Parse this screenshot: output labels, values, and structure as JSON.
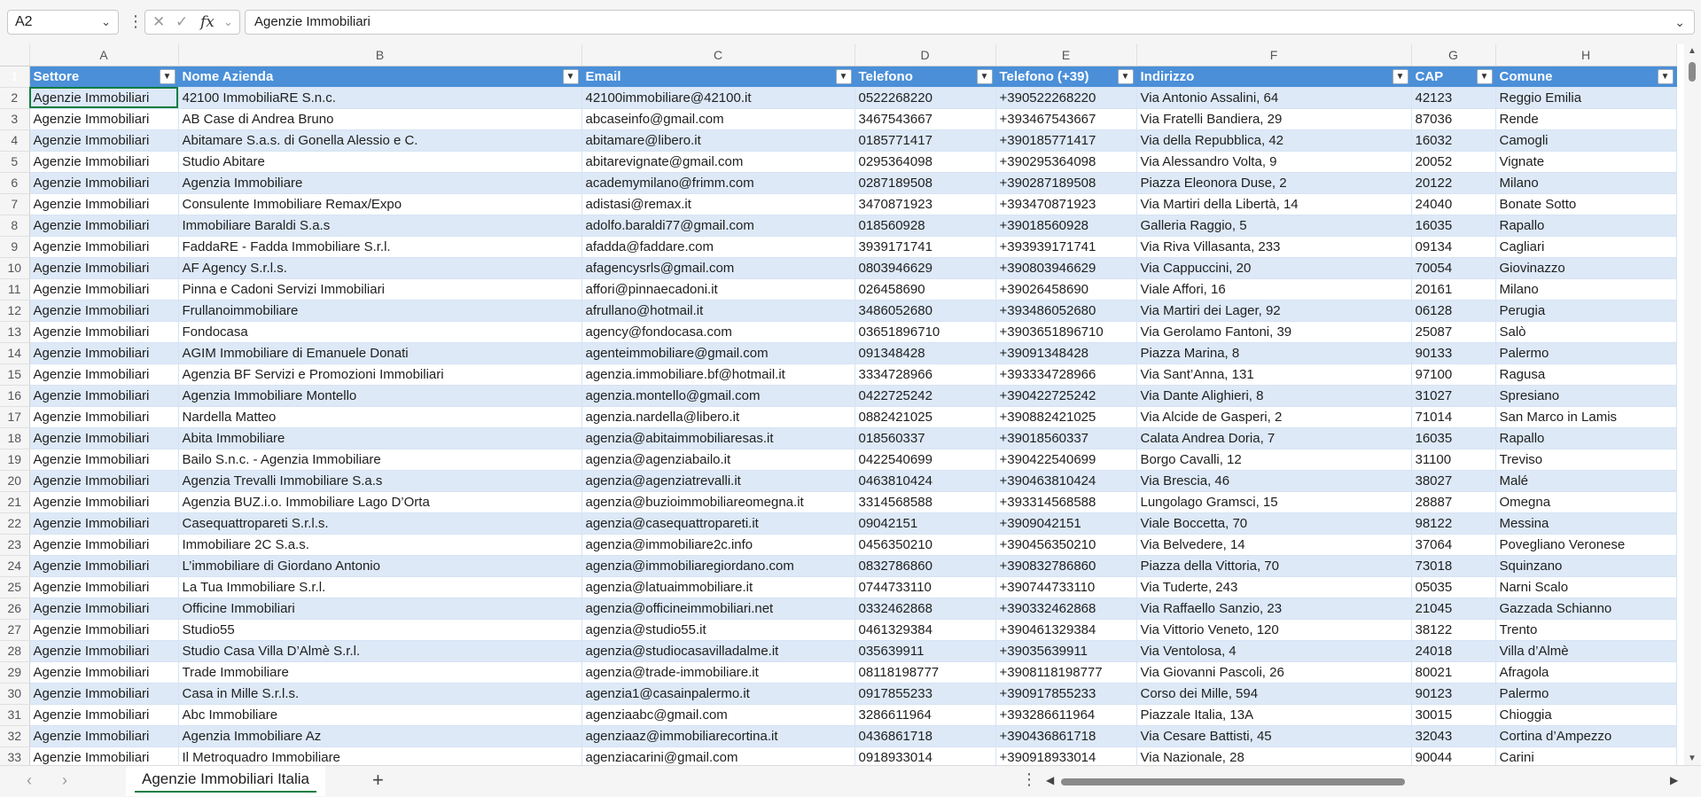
{
  "formula_bar": {
    "name_box": "A2",
    "formula_value": "Agenzie Immobiliari"
  },
  "columns": [
    "A",
    "B",
    "C",
    "D",
    "E",
    "F",
    "G",
    "H"
  ],
  "table_headers": [
    "Settore",
    "Nome Azienda",
    "Email",
    "Telefono",
    "Telefono (+39)",
    "Indirizzo",
    "CAP",
    "Comune"
  ],
  "row_numbers": [
    "1",
    "2",
    "3",
    "4",
    "5",
    "6",
    "7",
    "8",
    "9",
    "10",
    "11",
    "12",
    "13",
    "14",
    "15",
    "16",
    "17",
    "18",
    "19",
    "20",
    "21",
    "22",
    "23",
    "24",
    "25",
    "26",
    "27",
    "28",
    "29",
    "30",
    "31",
    "32",
    "33"
  ],
  "rows": [
    [
      "Agenzie Immobiliari",
      "42100 ImmobiliaRE S.n.c.",
      "42100immobiliare@42100.it",
      "0522268220",
      "+390522268220",
      "Via Antonio Assalini, 64",
      "42123",
      "Reggio Emilia"
    ],
    [
      "Agenzie Immobiliari",
      "AB Case di Andrea Bruno",
      "abcaseinfo@gmail.com",
      "3467543667",
      "+393467543667",
      "Via Fratelli Bandiera, 29",
      "87036",
      "Rende"
    ],
    [
      "Agenzie Immobiliari",
      "Abitamare S.a.s. di Gonella Alessio e C.",
      "abitamare@libero.it",
      "0185771417",
      "+390185771417",
      "Via della Repubblica, 42",
      "16032",
      "Camogli"
    ],
    [
      "Agenzie Immobiliari",
      "Studio Abitare",
      "abitarevignate@gmail.com",
      "0295364098",
      "+390295364098",
      "Via Alessandro Volta, 9",
      "20052",
      "Vignate"
    ],
    [
      "Agenzie Immobiliari",
      "Agenzia Immobiliare",
      "academymilano@frimm.com",
      "0287189508",
      "+390287189508",
      "Piazza Eleonora Duse, 2",
      "20122",
      "Milano"
    ],
    [
      "Agenzie Immobiliari",
      "Consulente Immobiliare Remax/Expo",
      "adistasi@remax.it",
      "3470871923",
      "+393470871923",
      "Via Martiri della Libertà, 14",
      "24040",
      "Bonate Sotto"
    ],
    [
      "Agenzie Immobiliari",
      "Immobiliare Baraldi S.a.s",
      "adolfo.baraldi77@gmail.com",
      "018560928",
      "+39018560928",
      "Galleria Raggio, 5",
      "16035",
      "Rapallo"
    ],
    [
      "Agenzie Immobiliari",
      "FaddaRE - Fadda Immobiliare S.r.l.",
      "afadda@faddare.com",
      "3939171741",
      "+393939171741",
      "Via Riva Villasanta, 233",
      "09134",
      "Cagliari"
    ],
    [
      "Agenzie Immobiliari",
      "AF Agency S.r.l.s.",
      "afagencysrls@gmail.com",
      "0803946629",
      "+390803946629",
      "Via Cappuccini, 20",
      "70054",
      "Giovinazzo"
    ],
    [
      "Agenzie Immobiliari",
      "Pinna e Cadoni Servizi Immobiliari",
      "affori@pinnaecadoni.it",
      "026458690",
      "+39026458690",
      "Viale Affori, 16",
      "20161",
      "Milano"
    ],
    [
      "Agenzie Immobiliari",
      "Frullanoimmobiliare",
      "afrullano@hotmail.it",
      "3486052680",
      "+393486052680",
      "Via Martiri dei Lager, 92",
      "06128",
      "Perugia"
    ],
    [
      "Agenzie Immobiliari",
      "Fondocasa",
      "agency@fondocasa.com",
      "03651896710",
      "+3903651896710",
      "Via Gerolamo Fantoni, 39",
      "25087",
      "Salò"
    ],
    [
      "Agenzie Immobiliari",
      "AGIM Immobiliare di Emanuele Donati",
      "agenteimmobiliare@gmail.com",
      "091348428",
      "+39091348428",
      "Piazza Marina, 8",
      "90133",
      "Palermo"
    ],
    [
      "Agenzie Immobiliari",
      "Agenzia BF Servizi e Promozioni Immobiliari",
      "agenzia.immobiliare.bf@hotmail.it",
      "3334728966",
      "+393334728966",
      "Via Sant’Anna, 131",
      "97100",
      "Ragusa"
    ],
    [
      "Agenzie Immobiliari",
      "Agenzia Immobiliare Montello",
      "agenzia.montello@gmail.com",
      "0422725242",
      "+390422725242",
      "Via Dante Alighieri, 8",
      "31027",
      "Spresiano"
    ],
    [
      "Agenzie Immobiliari",
      "Nardella Matteo",
      "agenzia.nardella@libero.it",
      "0882421025",
      "+390882421025",
      "Via Alcide de Gasperi, 2",
      "71014",
      "San Marco in Lamis"
    ],
    [
      "Agenzie Immobiliari",
      "Abita Immobiliare",
      "agenzia@abitaimmobiliaresas.it",
      "018560337",
      "+39018560337",
      "Calata Andrea Doria, 7",
      "16035",
      "Rapallo"
    ],
    [
      "Agenzie Immobiliari",
      "Bailo S.n.c. - Agenzia Immobiliare",
      "agenzia@agenziabailo.it",
      "0422540699",
      "+390422540699",
      "Borgo Cavalli, 12",
      "31100",
      "Treviso"
    ],
    [
      "Agenzie Immobiliari",
      "Agenzia Trevalli Immobiliare S.a.s",
      "agenzia@agenziatrevalli.it",
      "0463810424",
      "+390463810424",
      "Via Brescia, 46",
      "38027",
      "Malé"
    ],
    [
      "Agenzie Immobiliari",
      "Agenzia BUZ.i.o. Immobiliare Lago D’Orta",
      "agenzia@buzioimmobiliareomegna.it",
      "3314568588",
      "+393314568588",
      "Lungolago Gramsci, 15",
      "28887",
      "Omegna"
    ],
    [
      "Agenzie Immobiliari",
      "Casequattropareti S.r.l.s.",
      "agenzia@casequattropareti.it",
      "09042151",
      "+3909042151",
      "Viale Boccetta, 70",
      "98122",
      "Messina"
    ],
    [
      "Agenzie Immobiliari",
      "Immobiliare 2C S.a.s.",
      "agenzia@immobiliare2c.info",
      "0456350210",
      "+390456350210",
      "Via Belvedere, 14",
      "37064",
      "Povegliano Veronese"
    ],
    [
      "Agenzie Immobiliari",
      "L’immobiliare di Giordano Antonio",
      "agenzia@immobiliaregiordano.com",
      "0832786860",
      "+390832786860",
      "Piazza della Vittoria, 70",
      "73018",
      "Squinzano"
    ],
    [
      "Agenzie Immobiliari",
      "La Tua Immobiliare S.r.l.",
      "agenzia@latuaimmobiliare.it",
      "0744733110",
      "+390744733110",
      "Via Tuderte, 243",
      "05035",
      "Narni Scalo"
    ],
    [
      "Agenzie Immobiliari",
      "Officine Immobiliari",
      "agenzia@officineimmobiliari.net",
      "0332462868",
      "+390332462868",
      "Via Raffaello Sanzio, 23",
      "21045",
      "Gazzada Schianno"
    ],
    [
      "Agenzie Immobiliari",
      "Studio55",
      "agenzia@studio55.it",
      "0461329384",
      "+390461329384",
      "Via Vittorio Veneto, 120",
      "38122",
      "Trento"
    ],
    [
      "Agenzie Immobiliari",
      "Studio Casa Villa D’Almè S.r.l.",
      "agenzia@studiocasavilladalme.it",
      "035639911",
      "+39035639911",
      "Via Ventolosa, 4",
      "24018",
      "Villa d’Almè"
    ],
    [
      "Agenzie Immobiliari",
      "Trade Immobiliare",
      "agenzia@trade-immobiliare.it",
      "08118198777",
      "+3908118198777",
      "Via Giovanni Pascoli, 26",
      "80021",
      "Afragola"
    ],
    [
      "Agenzie Immobiliari",
      "Casa in Mille S.r.l.s.",
      "agenzia1@casainpalermo.it",
      "0917855233",
      "+390917855233",
      "Corso dei Mille, 594",
      "90123",
      "Palermo"
    ],
    [
      "Agenzie Immobiliari",
      "Abc Immobiliare",
      "agenziaabc@gmail.com",
      "3286611964",
      "+393286611964",
      "Piazzale Italia, 13A",
      "30015",
      "Chioggia"
    ],
    [
      "Agenzie Immobiliari",
      "Agenzia Immobiliare Az",
      "agenziaaz@immobiliarecortina.it",
      "0436861718",
      "+390436861718",
      "Via Cesare Battisti, 45",
      "32043",
      "Cortina d’Ampezzo"
    ],
    [
      "Agenzie Immobiliari",
      "Il Metroquadro Immobiliare",
      "agenziacarini@gmail.com",
      "0918933014",
      "+390918933014",
      "Via Nazionale, 28",
      "90044",
      "Carini"
    ]
  ],
  "sheet_tabs": [
    "Agenzie Immobiliari Italia"
  ],
  "icons": {
    "name_box_dropdown": "chevron-down-icon",
    "cancel": "close-icon",
    "enter": "check-icon",
    "function": "fx-icon",
    "filter": "filter-dropdown-icon",
    "add_sheet": "plus-icon"
  },
  "colors": {
    "header_fill": "#4a8fd8",
    "band_fill": "#dde9f7",
    "selection": "#107c41"
  }
}
